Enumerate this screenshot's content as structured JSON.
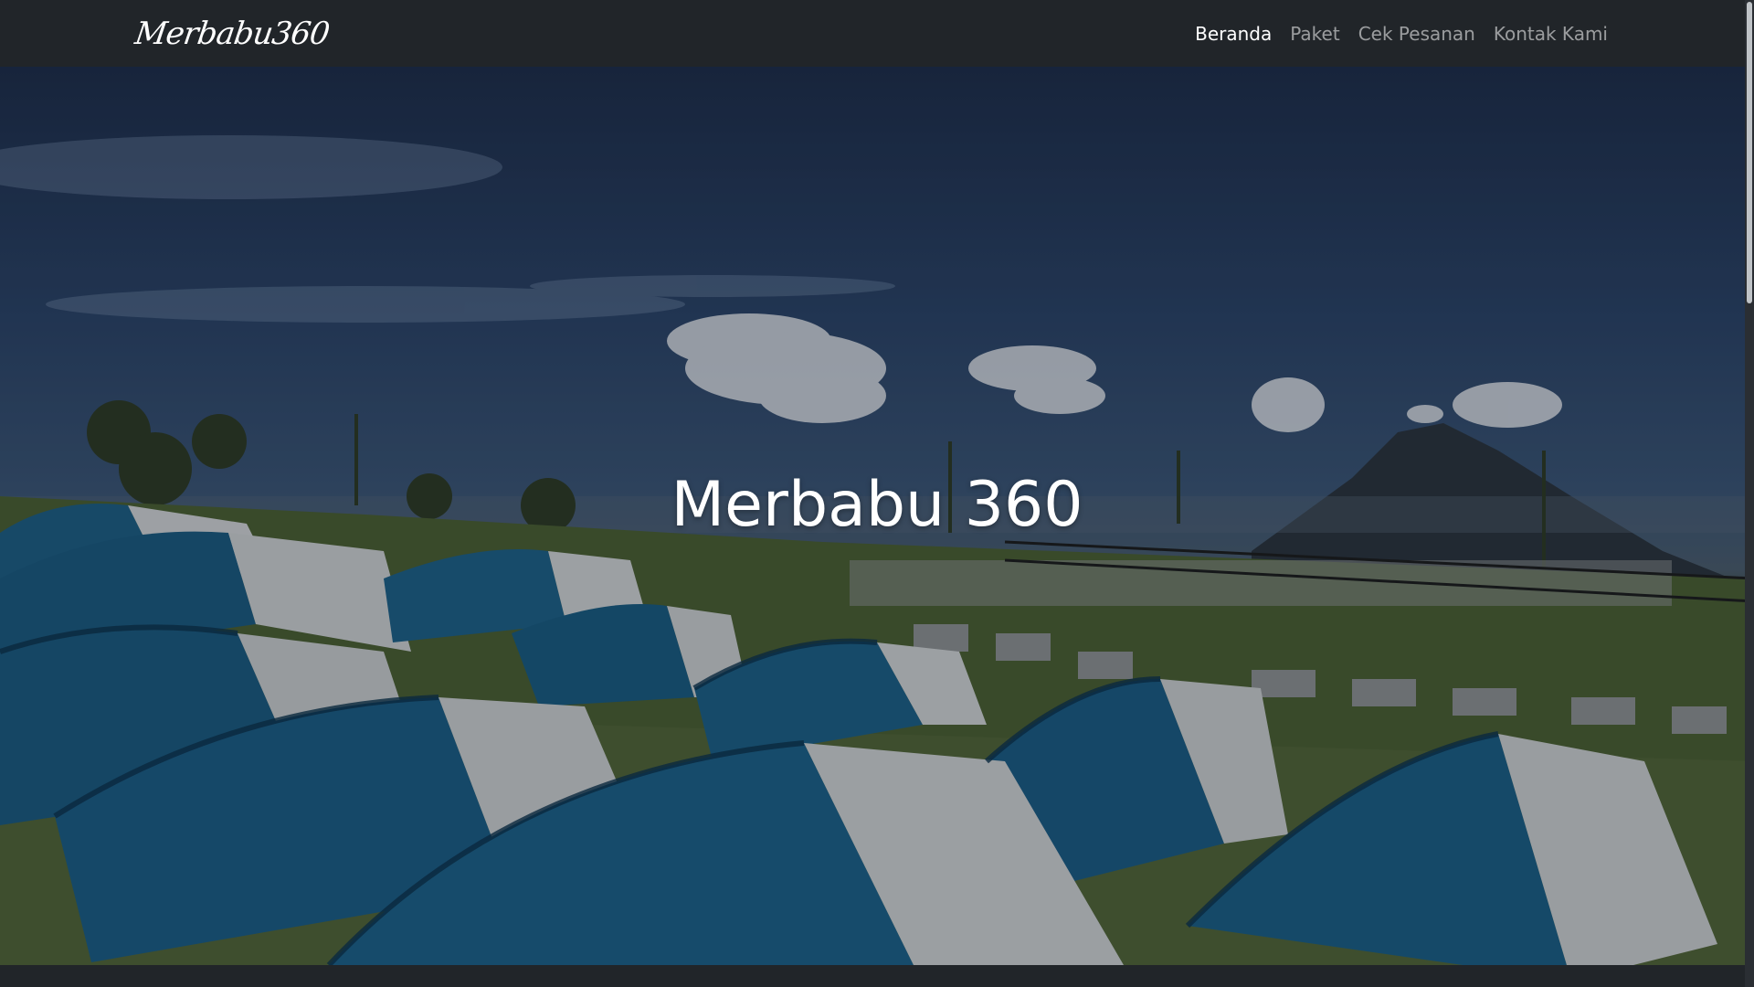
{
  "brand": {
    "name": "Merbabu360"
  },
  "nav": {
    "items": [
      {
        "label": "Beranda",
        "active": true
      },
      {
        "label": "Paket",
        "active": false
      },
      {
        "label": "Cek Pesanan",
        "active": false
      },
      {
        "label": "Kontak Kami",
        "active": false
      }
    ]
  },
  "hero": {
    "title": "Merbabu 360",
    "image_description_icon": "camping-tents-mountain-photo"
  },
  "colors": {
    "navbar_bg": "#212529",
    "nav_active": "#ffffff",
    "nav_inactive": "#8c8f93",
    "tent_blue": "#1d5f86"
  }
}
